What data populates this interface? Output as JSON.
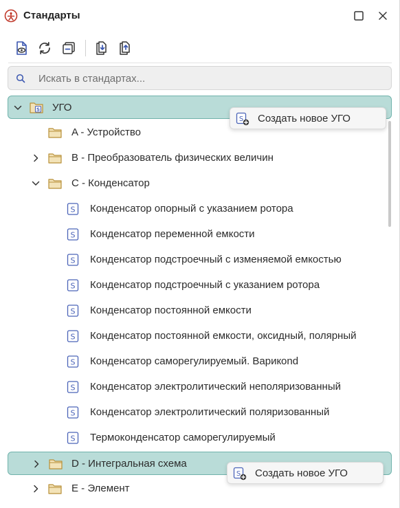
{
  "window": {
    "title": "Стандарты",
    "icons": {
      "app": "standards-logo-icon",
      "maximize": "maximize-icon",
      "close": "close-icon"
    }
  },
  "toolbar": {
    "buttons": [
      {
        "name": "preview-document-button",
        "icon": "document-eye-icon"
      },
      {
        "name": "refresh-button",
        "icon": "refresh-icon"
      },
      {
        "name": "collapse-all-button",
        "icon": "collapse-icon"
      },
      {
        "name": "import-button",
        "icon": "document-import-icon"
      },
      {
        "name": "export-button",
        "icon": "document-export-icon"
      }
    ]
  },
  "search": {
    "placeholder": "Искать в стандартах...",
    "value": ""
  },
  "tree": {
    "root": {
      "label": "УГО",
      "expanded": true,
      "selected": true
    },
    "groups": [
      {
        "label": "A - Устройство",
        "expandable": false
      },
      {
        "label": "B - Преобразователь физических величин",
        "expandable": true,
        "expanded": false
      },
      {
        "label": "C - Конденсатор",
        "expandable": true,
        "expanded": true,
        "items": [
          "Конденсатор опорный с указанием ротора",
          "Конденсатор переменной емкости",
          "Конденсатор подстроечный с изменяемой емкостью",
          "Конденсатор подстроечный с указанием ротора",
          "Конденсатор постоянной емкости",
          "Конденсатор постоянной емкости, оксидный, полярный",
          "Конденсатор саморегулируемый. Варикond",
          "Конденсатор электролитический неполяризованный",
          "Конденсатор электролитический поляризованный",
          "Термоконденсатор саморегулируемый"
        ]
      },
      {
        "label": "D - Интегральная схема",
        "expandable": true,
        "expanded": false,
        "selected": true
      },
      {
        "label": "E - Элемент",
        "expandable": true,
        "expanded": false
      }
    ]
  },
  "popups": {
    "create_ugo_top": "Создать новое УГО",
    "create_ugo_bottom": "Создать новое УГО"
  },
  "colors": {
    "selection_bg": "#b9dcd8",
    "selection_border": "#6fb2ab",
    "folder": "#c9a24a",
    "standard_icon": "#4a63b8",
    "app_icon": "#c0392b"
  }
}
